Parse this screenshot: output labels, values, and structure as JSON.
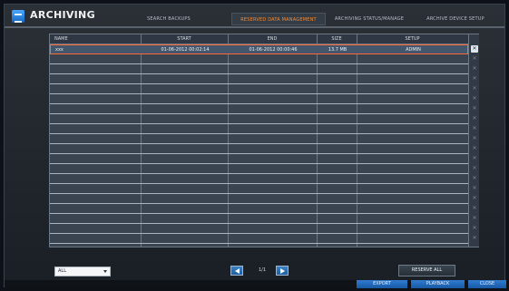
{
  "app": {
    "title": "ARCHIVING",
    "icon": "archive-icon"
  },
  "tabs": [
    {
      "label": "SEARCH BACKUPS",
      "active": false
    },
    {
      "label": "RESERVED DATA MANAGEMENT",
      "active": true
    },
    {
      "label": "ARCHIVING STATUS/MANAGE",
      "active": false
    },
    {
      "label": "ARCHIVE DEVICE SETUP",
      "active": false
    }
  ],
  "table": {
    "columns": [
      "NAME",
      "START",
      "END",
      "SIZE",
      "SETUP"
    ],
    "rows": [
      {
        "name": "xxx",
        "start": "01-06-2012 00:02:14",
        "end": "01-06-2012 00:00:46",
        "size": "13.7 MB",
        "setup": "ADMIN"
      }
    ],
    "empty_rows": 20,
    "delete_icon": "close-icon"
  },
  "filter": {
    "value": "ALL"
  },
  "pager": {
    "text": "1/1"
  },
  "buttons": {
    "reserve": "RESERVE ALL",
    "export": "EXPORT",
    "playback": "PLAYBACK",
    "close": "CLOSE"
  },
  "colors": {
    "accent": "#ff8a2a",
    "highlight": "#ff6a3a",
    "button_blue": "#1b5f9f"
  }
}
